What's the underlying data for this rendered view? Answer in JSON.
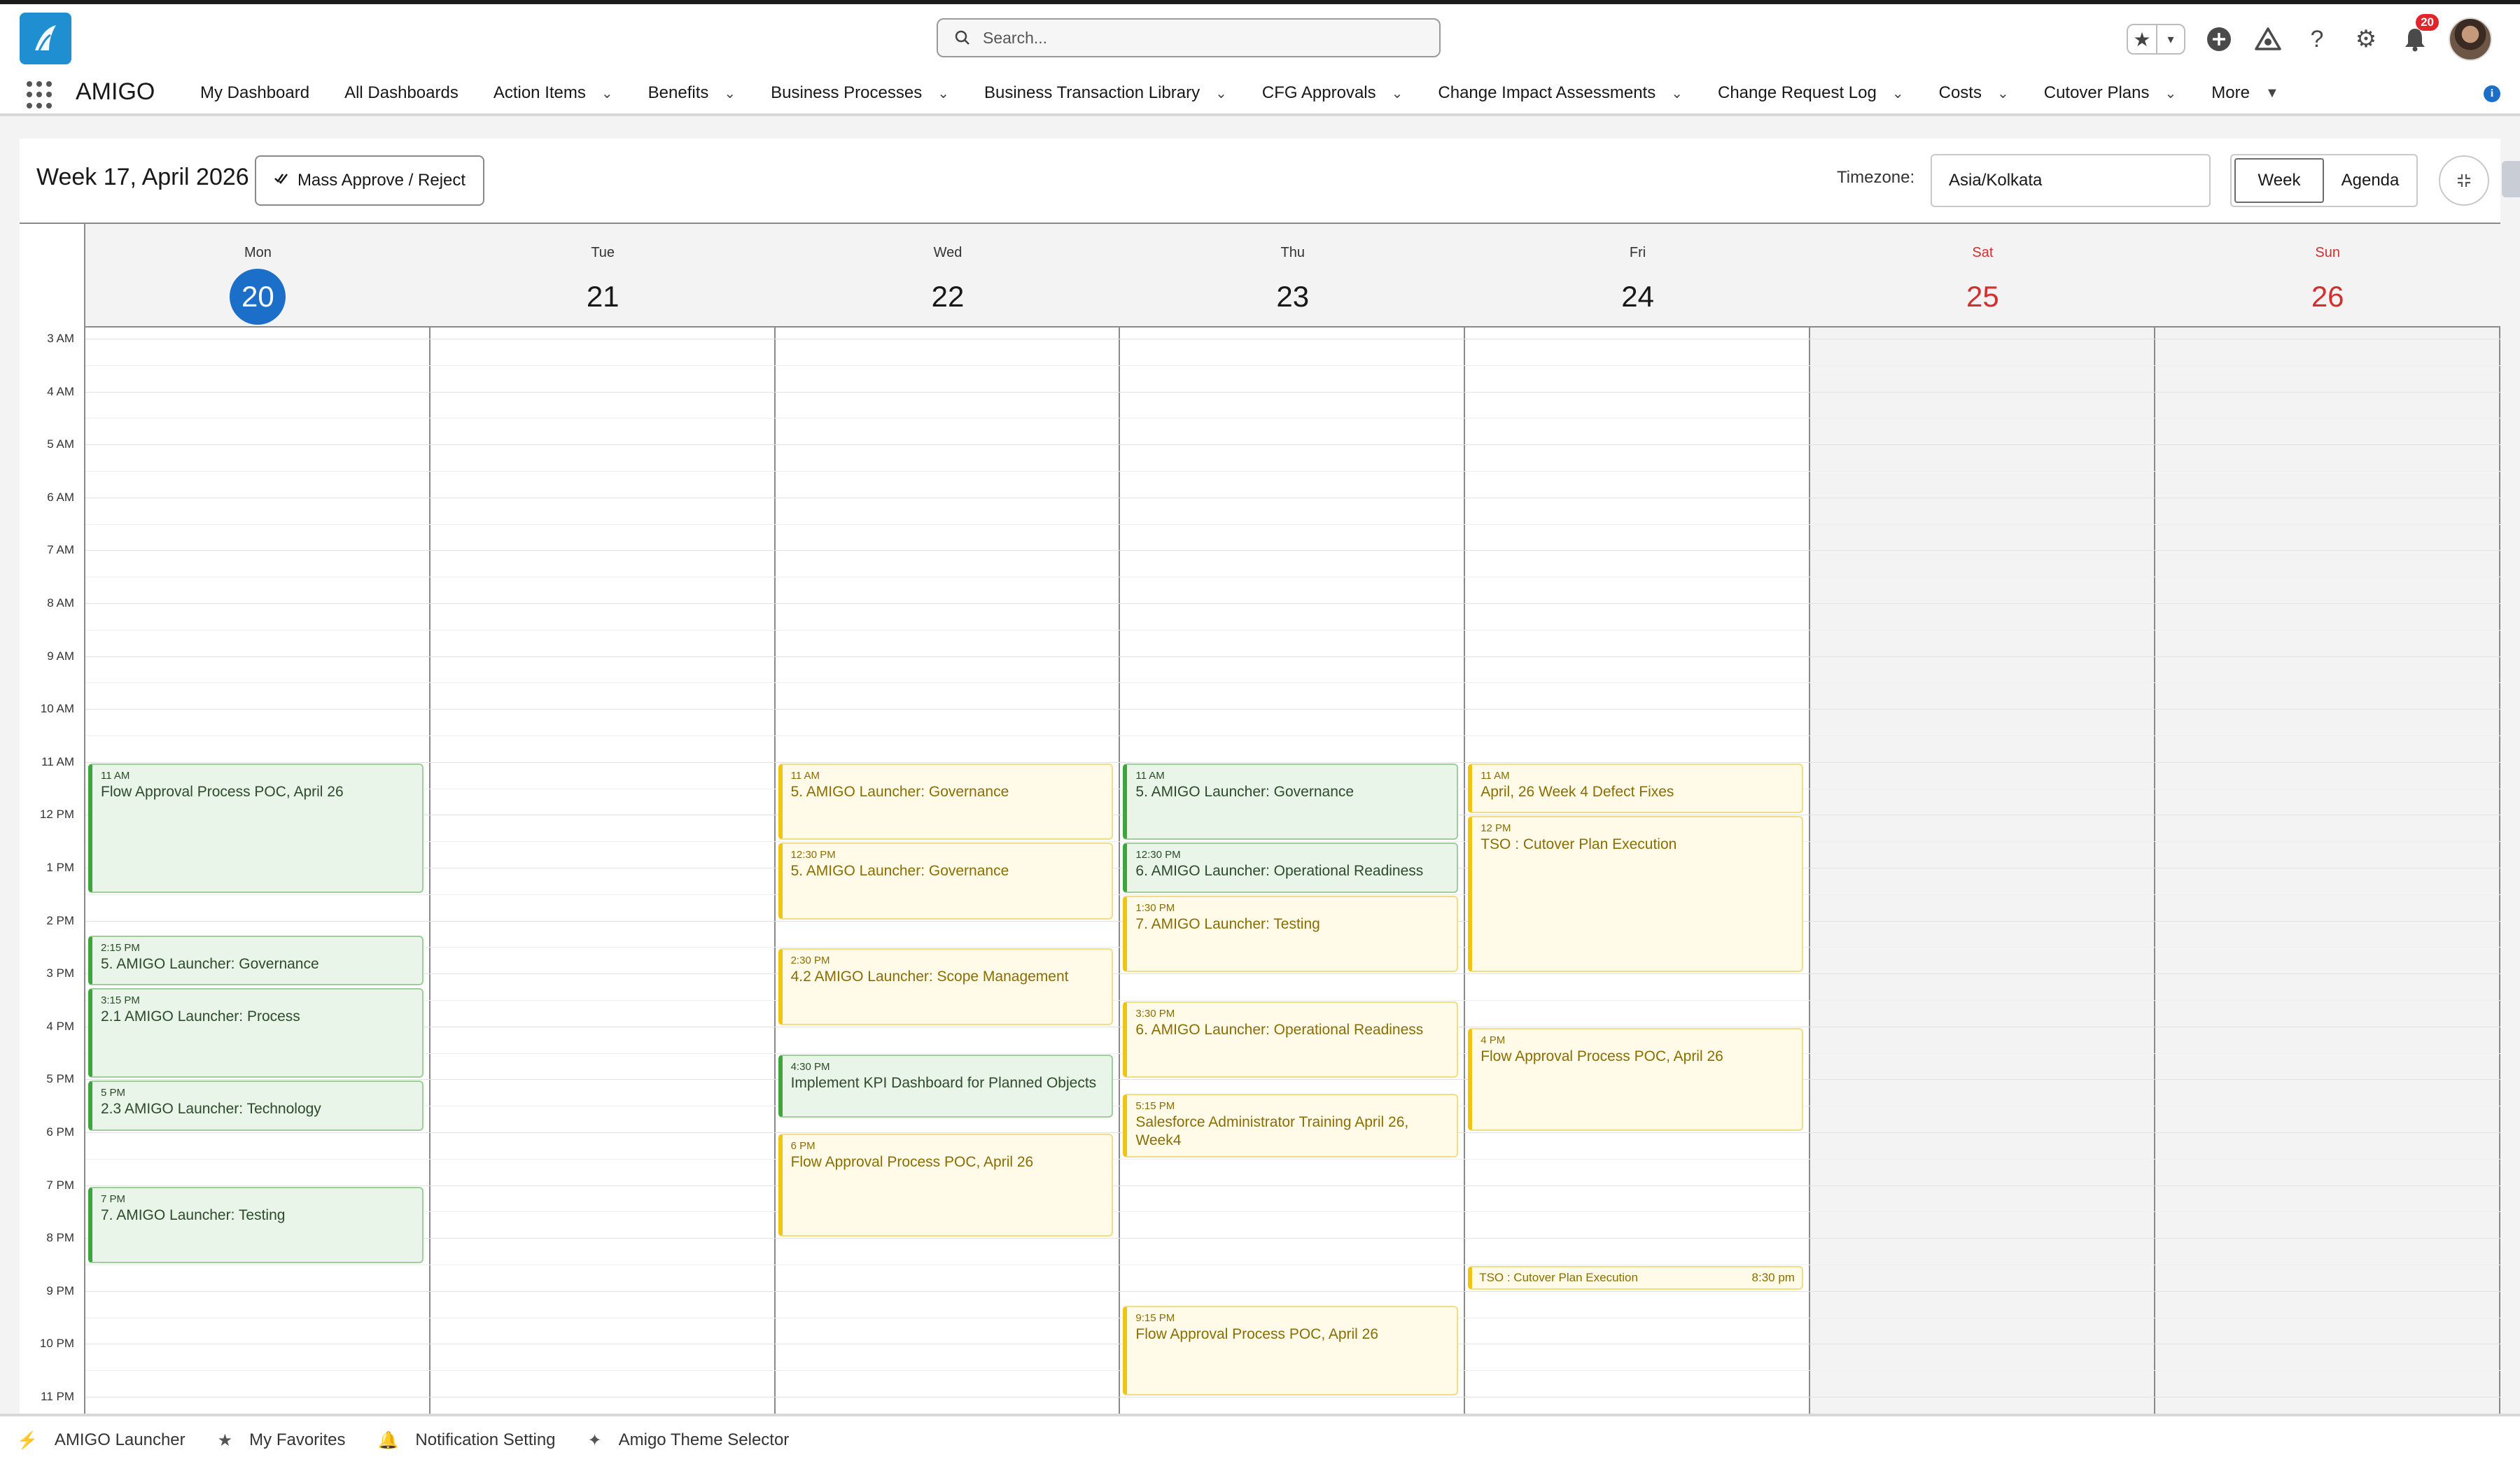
{
  "header": {
    "search_placeholder": "Search...",
    "notification_count": "20"
  },
  "nav": {
    "app_name": "AMIGO",
    "items": [
      {
        "label": "My Dashboard",
        "dropdown": false
      },
      {
        "label": "All Dashboards",
        "dropdown": false
      },
      {
        "label": "Action Items",
        "dropdown": true
      },
      {
        "label": "Benefits",
        "dropdown": true
      },
      {
        "label": "Business Processes",
        "dropdown": true
      },
      {
        "label": "Business Transaction Library",
        "dropdown": true
      },
      {
        "label": "CFG Approvals",
        "dropdown": true
      },
      {
        "label": "Change Impact Assessments",
        "dropdown": true
      },
      {
        "label": "Change Request Log",
        "dropdown": true
      },
      {
        "label": "Costs",
        "dropdown": true
      },
      {
        "label": "Cutover Plans",
        "dropdown": true
      },
      {
        "label": "More",
        "dropdown": true
      }
    ]
  },
  "toolbar": {
    "week_title": "Week 17, April 2026",
    "mass_button": "Mass Approve / Reject",
    "timezone_label": "Timezone:",
    "timezone_value": "Asia/Kolkata",
    "view_week": "Week",
    "view_agenda": "Agenda"
  },
  "calendar": {
    "hours": [
      "3 AM",
      "4 AM",
      "5 AM",
      "6 AM",
      "7 AM",
      "8 AM",
      "9 AM",
      "10 AM",
      "11 AM",
      "12 PM",
      "1 PM",
      "2 PM",
      "3 PM",
      "4 PM",
      "5 PM",
      "6 PM",
      "7 PM",
      "8 PM",
      "9 PM",
      "10 PM",
      "11 PM"
    ],
    "days": [
      {
        "name": "Mon",
        "num": "20",
        "today": true,
        "weekend": false
      },
      {
        "name": "Tue",
        "num": "21",
        "today": false,
        "weekend": false
      },
      {
        "name": "Wed",
        "num": "22",
        "today": false,
        "weekend": false
      },
      {
        "name": "Thu",
        "num": "23",
        "today": false,
        "weekend": false
      },
      {
        "name": "Fri",
        "num": "24",
        "today": false,
        "weekend": false
      },
      {
        "name": "Sat",
        "num": "25",
        "today": false,
        "weekend": true
      },
      {
        "name": "Sun",
        "num": "26",
        "today": false,
        "weekend": true
      }
    ],
    "events": [
      {
        "day": 0,
        "start": 11,
        "end": 13.5,
        "time": "11 AM",
        "title": "Flow Approval Process POC, April 26",
        "color": "green"
      },
      {
        "day": 0,
        "start": 14.25,
        "end": 15.25,
        "time": "2:15 PM",
        "title": "5. AMIGO Launcher: Governance",
        "color": "green"
      },
      {
        "day": 0,
        "start": 15.25,
        "end": 17,
        "time": "3:15 PM",
        "title": "2.1 AMIGO Launcher: Process",
        "color": "green"
      },
      {
        "day": 0,
        "start": 17,
        "end": 18,
        "time": "5 PM",
        "title": "2.3 AMIGO Launcher: Technology",
        "color": "green"
      },
      {
        "day": 0,
        "start": 19,
        "end": 20.5,
        "time": "7 PM",
        "title": "7. AMIGO Launcher: Testing",
        "color": "green"
      },
      {
        "day": 2,
        "start": 11,
        "end": 12.5,
        "time": "11 AM",
        "title": "5. AMIGO Launcher: Governance",
        "color": "yellow"
      },
      {
        "day": 2,
        "start": 12.5,
        "end": 14,
        "time": "12:30 PM",
        "title": "5. AMIGO Launcher: Governance",
        "color": "yellow"
      },
      {
        "day": 2,
        "start": 14.5,
        "end": 16,
        "time": "2:30 PM",
        "title": "4.2 AMIGO Launcher: Scope Management",
        "color": "yellow"
      },
      {
        "day": 2,
        "start": 16.5,
        "end": 17.75,
        "time": "4:30 PM",
        "title": "Implement KPI Dashboard for Planned Objects",
        "color": "green"
      },
      {
        "day": 2,
        "start": 18,
        "end": 20,
        "time": "6 PM",
        "title": "Flow Approval Process POC, April 26",
        "color": "yellow"
      },
      {
        "day": 3,
        "start": 11,
        "end": 12.5,
        "time": "11 AM",
        "title": "5. AMIGO Launcher: Governance",
        "color": "green"
      },
      {
        "day": 3,
        "start": 12.5,
        "end": 13.5,
        "time": "12:30 PM",
        "title": "6. AMIGO Launcher: Operational Readiness",
        "color": "green"
      },
      {
        "day": 3,
        "start": 13.5,
        "end": 15,
        "time": "1:30 PM",
        "title": "7. AMIGO Launcher: Testing",
        "color": "yellow"
      },
      {
        "day": 3,
        "start": 15.5,
        "end": 17,
        "time": "3:30 PM",
        "title": "6. AMIGO Launcher: Operational Readiness",
        "color": "yellow"
      },
      {
        "day": 3,
        "start": 17.25,
        "end": 18.5,
        "time": "5:15 PM",
        "title": "Salesforce Administrator Training April 26, Week4",
        "color": "yellow"
      },
      {
        "day": 3,
        "start": 21.25,
        "end": 23,
        "time": "9:15 PM",
        "title": "Flow Approval Process POC, April 26",
        "color": "yellow"
      },
      {
        "day": 4,
        "start": 11,
        "end": 12,
        "time": "11 AM",
        "title": "April, 26 Week 4 Defect Fixes",
        "color": "yellow"
      },
      {
        "day": 4,
        "start": 12,
        "end": 15,
        "time": "12 PM",
        "title": "TSO : Cutover Plan Execution",
        "color": "yellow"
      },
      {
        "day": 4,
        "start": 16,
        "end": 18,
        "time": "4 PM",
        "title": "Flow Approval Process POC, April 26",
        "color": "yellow"
      },
      {
        "day": 4,
        "start": 20.5,
        "end": 21,
        "time": "8:30 pm",
        "title": "TSO : Cutover Plan Execution",
        "color": "yellow",
        "compact": true
      }
    ]
  },
  "footer": {
    "items": [
      {
        "label": "AMIGO Launcher",
        "icon": "lightning-icon"
      },
      {
        "label": "My Favorites",
        "icon": "star-icon"
      },
      {
        "label": "Notification Setting",
        "icon": "bell-icon"
      },
      {
        "label": "Amigo Theme Selector",
        "icon": "magic-wand-icon"
      }
    ]
  }
}
